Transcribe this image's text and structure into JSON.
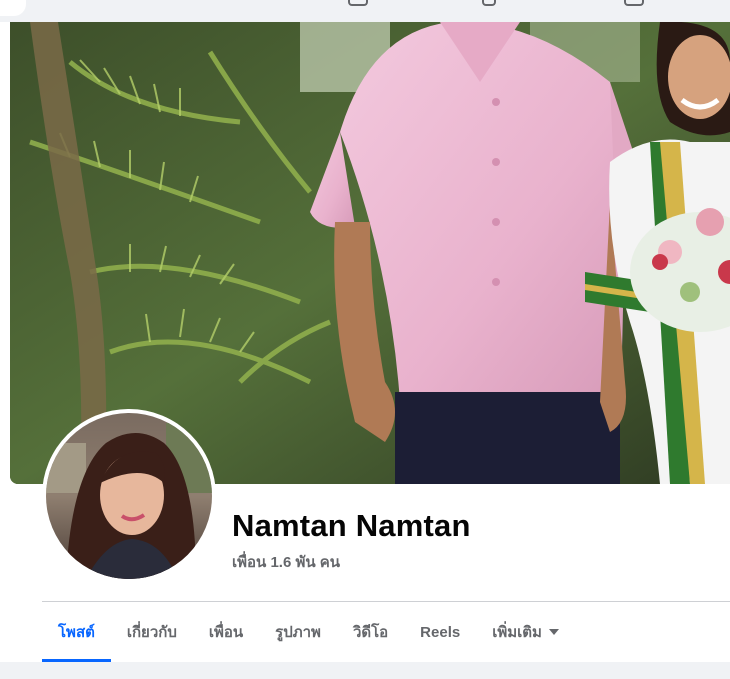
{
  "profile": {
    "name": "Namtan Namtan",
    "friends": "เพื่อน 1.6 พัน คน"
  },
  "tabs": [
    {
      "label": "โพสต์",
      "active": true
    },
    {
      "label": "เกี่ยวกับ",
      "active": false
    },
    {
      "label": "เพื่อน",
      "active": false
    },
    {
      "label": "รูปภาพ",
      "active": false
    },
    {
      "label": "วิดีโอ",
      "active": false
    },
    {
      "label": "Reels",
      "active": false
    },
    {
      "label": "เพิ่มเติม",
      "active": false
    }
  ],
  "icons": {
    "more_tab": "caret-down-icon"
  },
  "colors": {
    "accent": "#0866ff",
    "secondary_text": "#65676b",
    "primary_text": "#050505"
  }
}
